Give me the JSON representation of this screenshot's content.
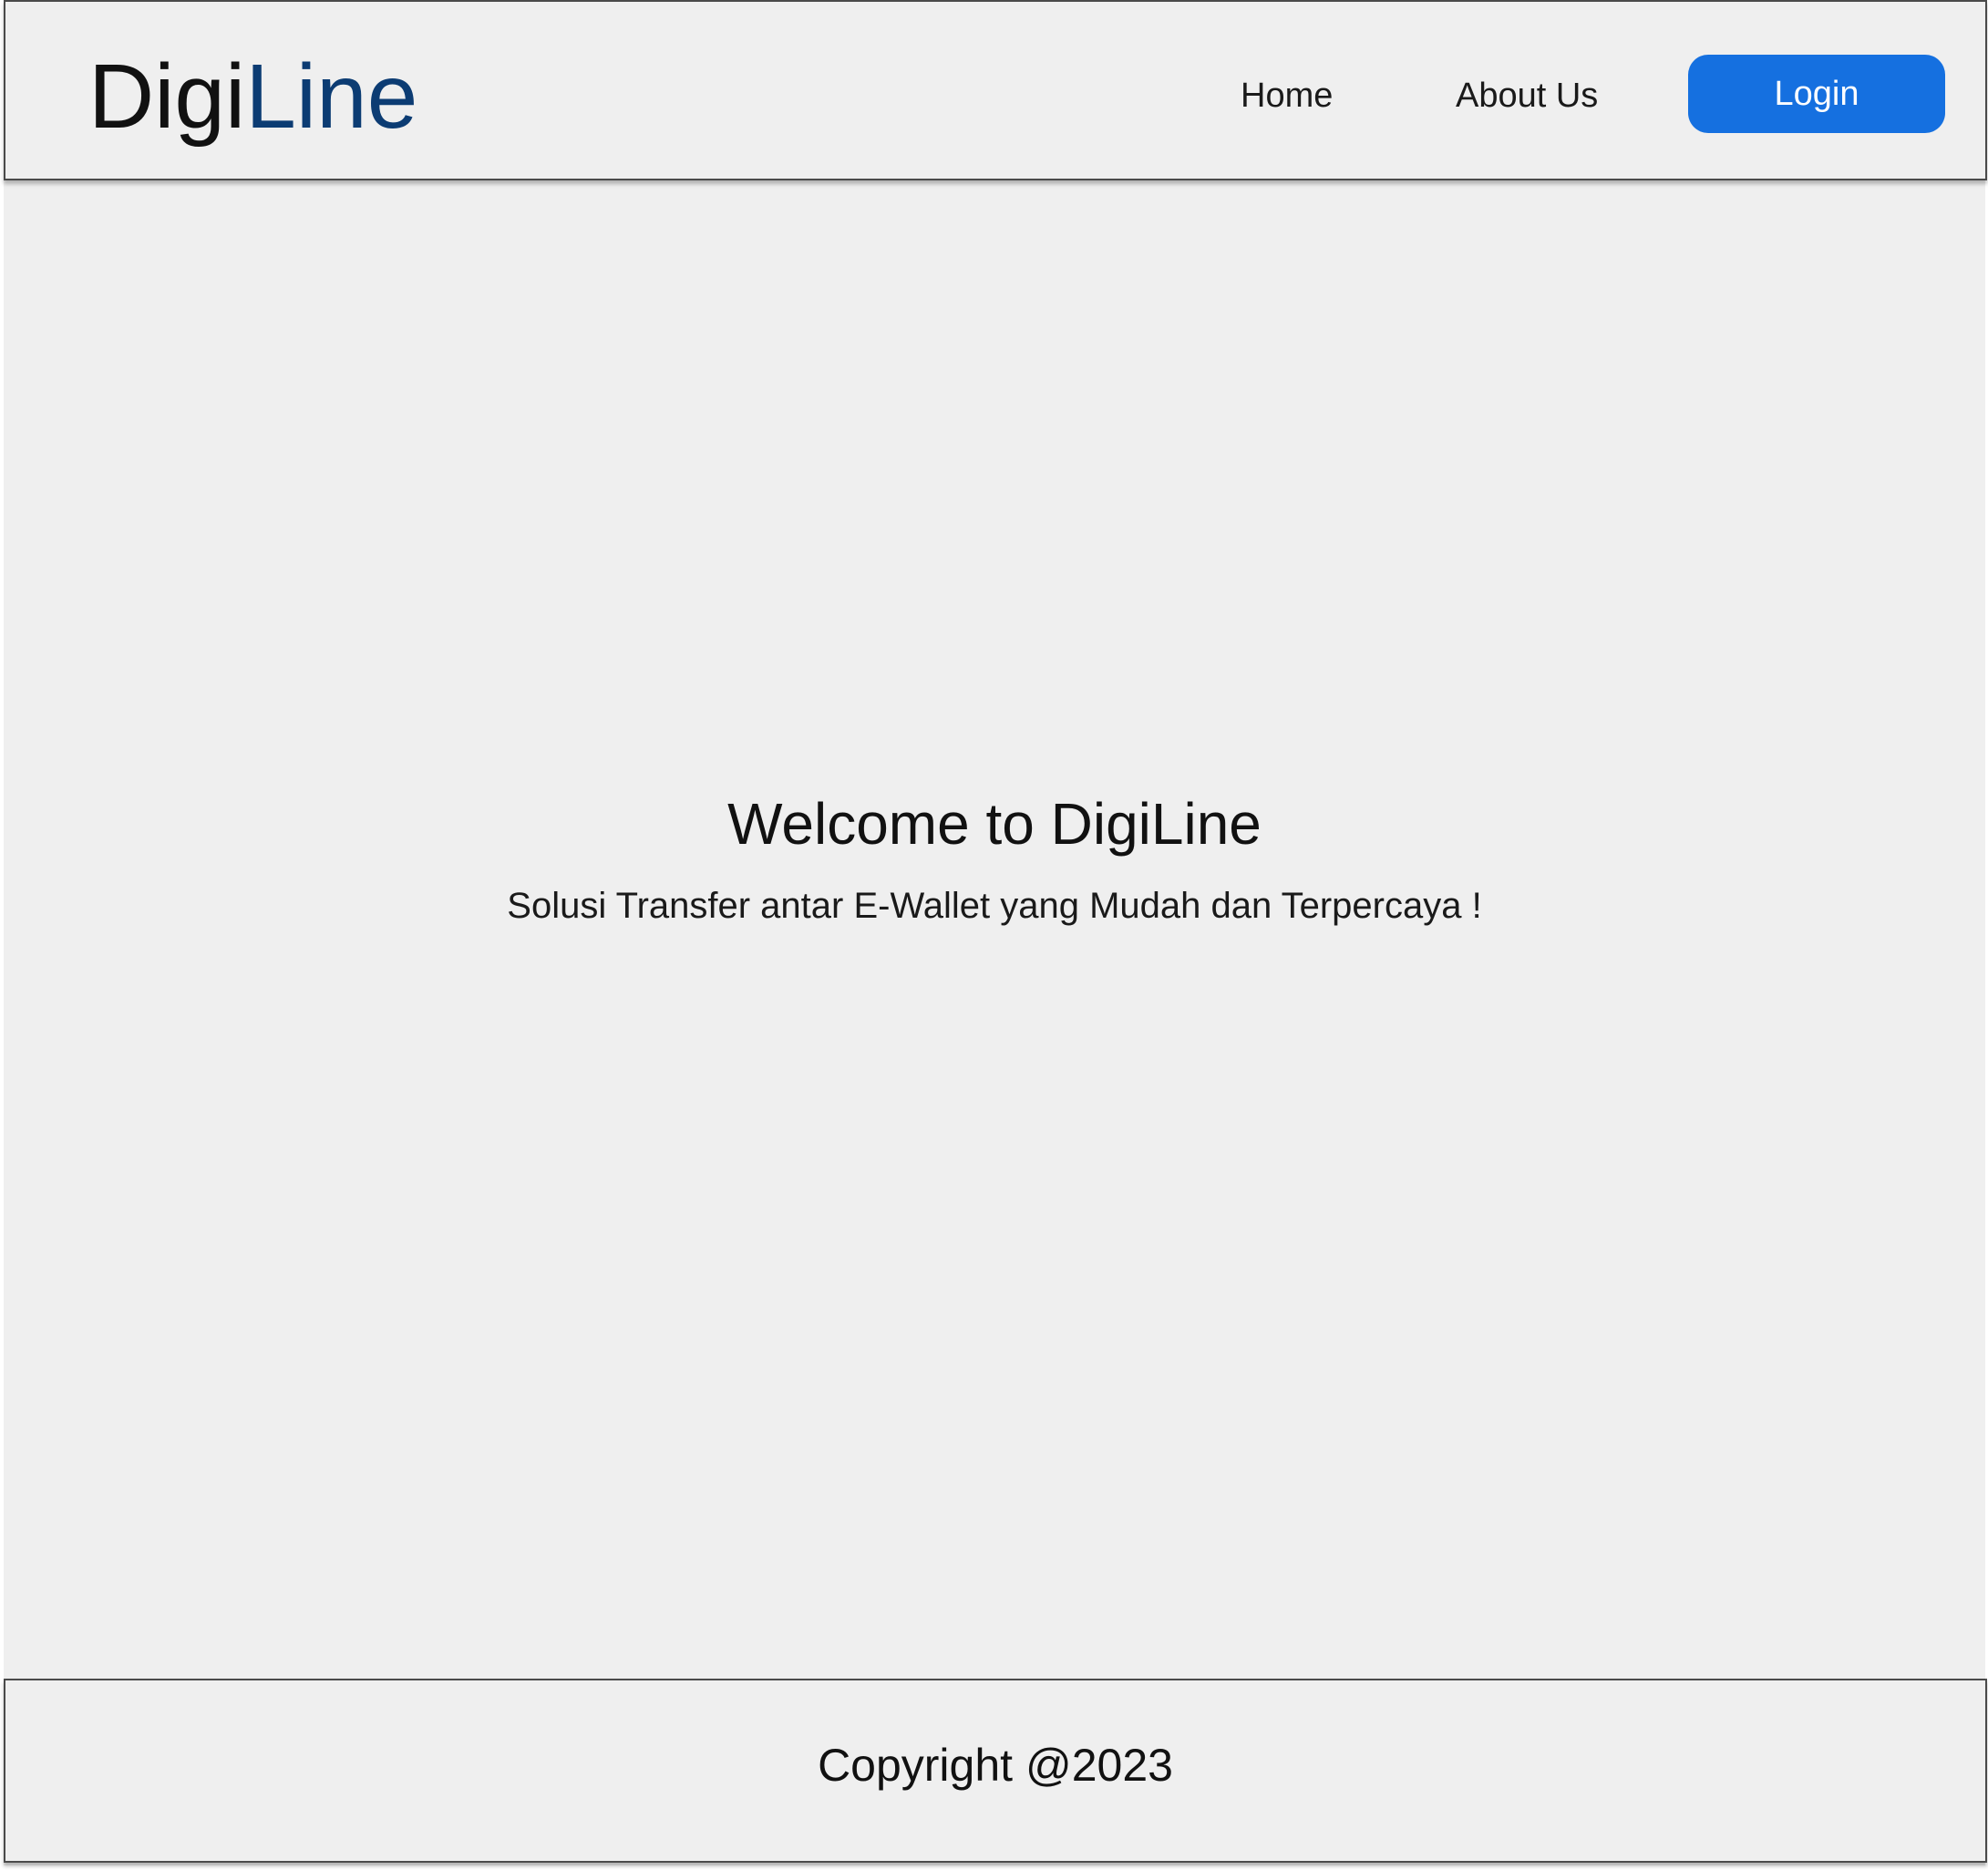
{
  "brand": {
    "name_part_1": "Digi",
    "name_part_2": "Line",
    "name_part_1_color": "#111111",
    "name_part_2_color": "#0c3c73"
  },
  "nav": {
    "items": [
      {
        "label": "Home"
      },
      {
        "label": "About Us"
      }
    ],
    "login_label": "Login",
    "login_color": "#1570e0"
  },
  "hero": {
    "title": "Welcome to DigiLine",
    "subtitle": "Solusi Transfer antar E-Wallet yang Mudah dan Terpercaya !"
  },
  "footer": {
    "copyright": "Copyright @2023"
  },
  "colors": {
    "background": "#efefef",
    "border": "#4a4a4a"
  }
}
